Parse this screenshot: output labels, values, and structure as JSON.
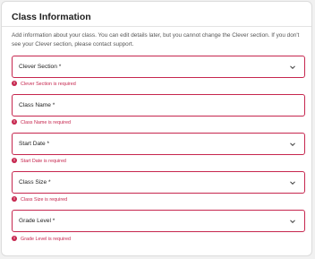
{
  "form": {
    "title": "Class Information",
    "description": "Add information about your class. You can edit details later, but you cannot change the Clever section. If you don't see your Clever section, please contact support.",
    "fields": [
      {
        "label": "Clever Section *",
        "error": "Clever Section is required",
        "type": "select"
      },
      {
        "label": "Class Name *",
        "error": "Class Name is required",
        "type": "text"
      },
      {
        "label": "Start Date *",
        "error": "Start Date is required",
        "type": "select"
      },
      {
        "label": "Class Size *",
        "error": "Class Size is required",
        "type": "select"
      },
      {
        "label": "Grade Level *",
        "error": "Grade Level is required",
        "type": "select"
      }
    ],
    "error_icon": "!"
  },
  "colors": {
    "error": "#c6264e",
    "border": "#dcdcdc",
    "background": "#f1f1f1"
  },
  "icons": {
    "chevron": "chevron-down-icon",
    "error": "alert-circle-icon"
  }
}
